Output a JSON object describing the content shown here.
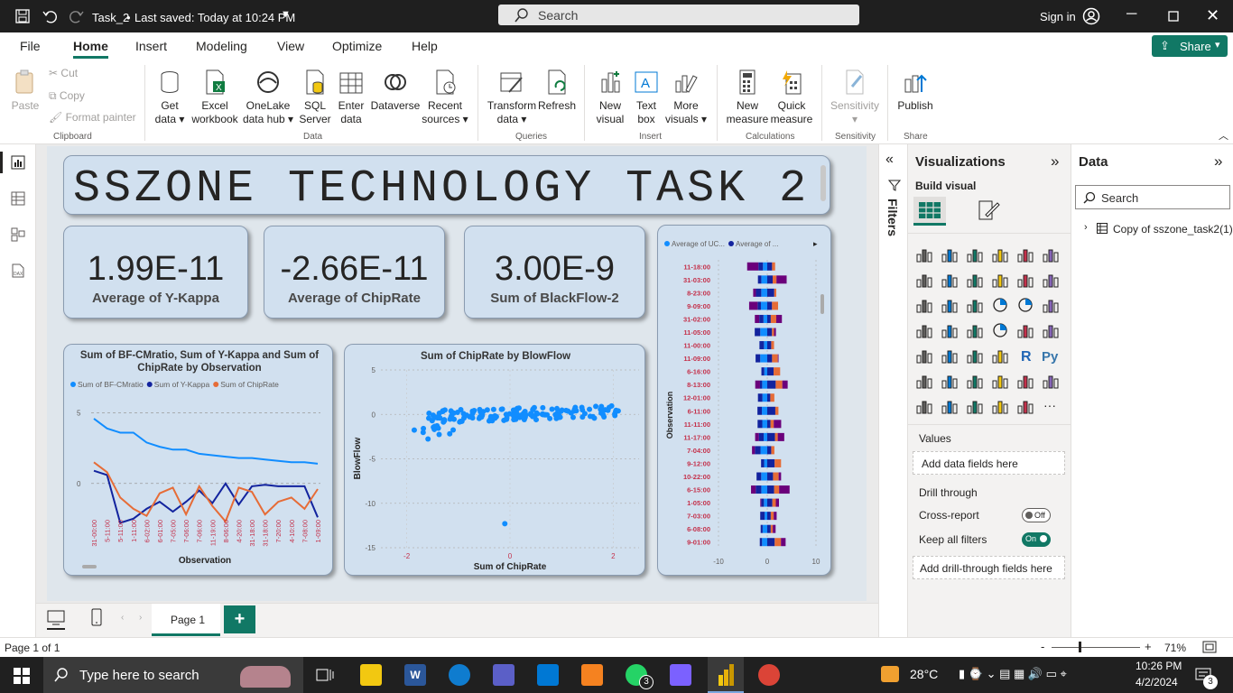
{
  "titlebar": {
    "file_title": "Task_2",
    "save_status": "Last saved: Today at 10:24 PM",
    "search_placeholder": "Search",
    "sign_in": "Sign in"
  },
  "menu": {
    "items": [
      "File",
      "Home",
      "Insert",
      "Modeling",
      "View",
      "Optimize",
      "Help"
    ],
    "active": "Home",
    "share_label": "Share"
  },
  "ribbon": {
    "clipboard": {
      "paste": "Paste",
      "cut": "Cut",
      "copy": "Copy",
      "format_painter": "Format painter",
      "group": "Clipboard"
    },
    "data": {
      "get_data": [
        "Get",
        "data"
      ],
      "excel": [
        "Excel",
        "workbook"
      ],
      "onelake": [
        "OneLake",
        "data hub"
      ],
      "sql": [
        "SQL",
        "Server"
      ],
      "enter": [
        "Enter",
        "data"
      ],
      "dataverse": "Dataverse",
      "recent": [
        "Recent",
        "sources"
      ],
      "group": "Data"
    },
    "queries": {
      "transform": [
        "Transform",
        "data"
      ],
      "refresh": "Refresh",
      "group": "Queries"
    },
    "insert": {
      "new_visual": [
        "New",
        "visual"
      ],
      "text_box": [
        "Text",
        "box"
      ],
      "more_visuals": [
        "More",
        "visuals"
      ],
      "group": "Insert"
    },
    "calculations": {
      "new_measure": [
        "New",
        "measure"
      ],
      "quick_measure": [
        "Quick",
        "measure"
      ],
      "group": "Calculations"
    },
    "sensitivity": {
      "label": "Sensitivity",
      "group": "Sensitivity"
    },
    "share": {
      "publish": "Publish",
      "group": "Share"
    }
  },
  "report": {
    "title": "SSZONE TECHNOLOGY TASK 2",
    "kpis": [
      {
        "value": "1.99E-11",
        "label": "Average of Y-Kappa"
      },
      {
        "value": "-2.66E-11",
        "label": "Average of ChipRate"
      },
      {
        "value": "3.00E-9",
        "label": "Sum of BlackFlow-2"
      }
    ]
  },
  "chart_data": [
    {
      "type": "line",
      "title": "Sum of BF-CMratio, Sum of Y-Kappa and Sum of ChipRate by Observation",
      "xlabel": "Observation",
      "ylabel": "",
      "ylim": [
        -2,
        6
      ],
      "yticks": [
        "5",
        "0"
      ],
      "categories": [
        "31-00:00",
        "5-11:00",
        "5-11:00",
        "1-11:00",
        "6-02:00",
        "6-01:00",
        "7-05:00",
        "7-06:00",
        "7-06:00",
        "11-19:00",
        "8-06:00",
        "4-20:00",
        "31-18:00",
        "31-18:00",
        "7-20:00",
        "4-10:00",
        "7-08:00",
        "1-09:00"
      ],
      "legend": [
        "Sum of BF-CMratio",
        "Sum of Y-Kappa",
        "Sum of ChipRate"
      ],
      "series": [
        {
          "name": "Sum of BF-CMratio",
          "color": "#118dff",
          "values": [
            4.6,
            3.9,
            3.6,
            3.6,
            2.9,
            2.6,
            2.4,
            2.4,
            2.1,
            2.0,
            1.9,
            1.8,
            1.8,
            1.7,
            1.6,
            1.5,
            1.5,
            1.4
          ]
        },
        {
          "name": "Sum of Y-Kappa",
          "color": "#12239e",
          "values": [
            0.9,
            0.6,
            -2.8,
            -2.5,
            -1.8,
            -1.3,
            -2.0,
            -1.3,
            -0.5,
            -1.4,
            0.0,
            -1.5,
            -0.2,
            -0.1,
            -0.2,
            -0.2,
            -0.2,
            -2.4
          ]
        },
        {
          "name": "Sum of ChipRate",
          "color": "#e66c37",
          "values": [
            1.5,
            0.8,
            -1.0,
            -1.8,
            -2.3,
            -0.7,
            -0.3,
            -2.2,
            -0.2,
            -1.6,
            -2.7,
            -0.3,
            -0.6,
            -2.2,
            -1.3,
            -1.0,
            -1.8,
            -0.4
          ]
        }
      ]
    },
    {
      "type": "scatter",
      "title": "Sum of ChipRate by BlowFlow",
      "xlabel": "Sum of ChipRate",
      "ylabel": "BlowFlow",
      "xlim": [
        -2.5,
        2.5
      ],
      "ylim": [
        -15,
        5
      ],
      "xticks": [
        "-2",
        "0",
        "2"
      ],
      "yticks": [
        "5",
        "0",
        "-5",
        "-10",
        "-15"
      ],
      "color": "#118dff",
      "outlier": {
        "x": -0.1,
        "y": -12.3
      }
    },
    {
      "type": "bar",
      "orientation": "horizontal-stacked",
      "ylabel": "Observation",
      "xlim": [
        -10,
        10
      ],
      "xticks": [
        "-10",
        "0",
        "10"
      ],
      "legend": [
        "Average of UC...",
        "Average of ..."
      ],
      "categories": [
        "11-18:00",
        "31-03:00",
        "8-23:00",
        "9-09:00",
        "31-02:00",
        "11-05:00",
        "11-00:00",
        "11-09:00",
        "6-16:00",
        "8-13:00",
        "12-01:00",
        "6-11:00",
        "11-11:00",
        "11-17:00",
        "7-04:00",
        "9-12:00",
        "10-22:00",
        "6-15:00",
        "1-05:00",
        "7-03:00",
        "6-08:00",
        "9-01:00"
      ]
    }
  ],
  "filters": {
    "label": "Filters"
  },
  "visualizations": {
    "title": "Visualizations",
    "build_visual": "Build visual",
    "values_label": "Values",
    "add_data_fields": "Add data fields here",
    "drill_through": "Drill through",
    "cross_report": "Cross-report",
    "cross_report_state": "Off",
    "keep_all_filters": "Keep all filters",
    "keep_all_filters_state": "On",
    "add_drill_fields": "Add drill-through fields here"
  },
  "data_pane": {
    "title": "Data",
    "search_placeholder": "Search",
    "table": "Copy of sszone_task2(1)"
  },
  "page_tabs": {
    "page1": "Page 1",
    "add": "+"
  },
  "status": {
    "page_info": "Page 1 of 1",
    "zoom": "71%"
  },
  "taskbar": {
    "search_placeholder": "Type here to search",
    "temperature": "28°C",
    "time": "10:26 PM",
    "date": "4/2/2024",
    "whatsapp_badge": "3",
    "notifications": "3"
  },
  "colors": {
    "accent_green": "#117865",
    "series_blue": "#118dff",
    "series_navy": "#12239e",
    "series_orange": "#e66c37",
    "series_purple": "#6b007b"
  }
}
